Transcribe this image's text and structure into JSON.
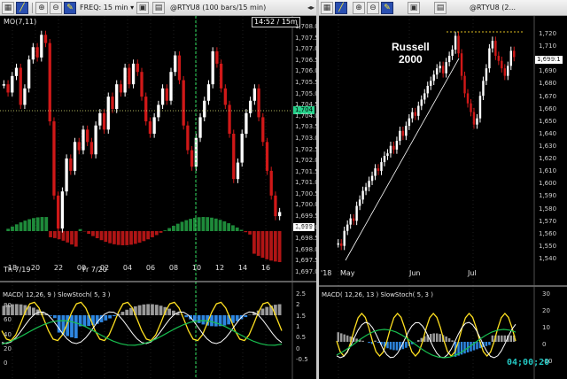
{
  "colors": {
    "background": "#000000",
    "up_bar": "#ffffff",
    "down_bar": "#d01818",
    "macd_up": "#9a9a9a",
    "macd_down": "#2e86e0",
    "macd_pos_green": "#1e8a3a",
    "macd_neg_red": "#b01515",
    "stoch_k": "#ffe020",
    "stoch_d": "#ffffff",
    "macd_line_green": "#18c050",
    "trend_line": "#ffffff",
    "resistance": "#e0c020",
    "timer": "#23c7c2"
  },
  "left": {
    "toolbar": {
      "freq_label": "FREQ: 15 min",
      "symbol_title": "@RTYU8 (100 bars/15 min)",
      "icons": [
        "cursor-icon",
        "draw-line-icon",
        "zoom-in-icon",
        "zoom-out-icon",
        "pin-icon",
        "save-icon",
        "folder-icon"
      ]
    },
    "indicator_label": "MO(7,11)",
    "time_badge": "14:52 / 15m",
    "current_price_tag": "1,704",
    "last_price_tag": "1,699",
    "price_axis": [
      "1,708.0",
      "1,707.5",
      "1,707.0",
      "1,706.5",
      "1,706.0",
      "1,705.5",
      "1,705.0",
      "1,704.5",
      "1,704.0",
      "1,703.5",
      "1,703.0",
      "1,702.5",
      "1,702.0",
      "1,701.5",
      "1,701.0",
      "1,700.5",
      "1,700.0",
      "1,699.5",
      "1,699.0",
      "1,698.5",
      "1,698.0",
      "1,697.5",
      "1,697.0"
    ],
    "time_axis": [
      "18",
      "20",
      "22",
      "00",
      "02",
      "04",
      "06",
      "08",
      "10",
      "12",
      "14",
      "16"
    ],
    "date_labels": [
      "Th 7/19",
      "Fr 7/20"
    ],
    "sub_panel": {
      "macd_label": "MACD( 12,26, 9 )",
      "stoch_label": "SlowStoch( 5, 3 )",
      "left_axis": [
        "80",
        "60",
        "40",
        "20",
        "0"
      ],
      "right_axis": [
        "2.5",
        "2",
        "1.5",
        "1",
        "0.5",
        "0",
        "-0.5"
      ]
    },
    "chart_data": {
      "type": "ohlc",
      "ylim": [
        1697.0,
        1708.0
      ],
      "closes": [
        1705.2,
        1704.8,
        1705.6,
        1706.0,
        1704.2,
        1705.0,
        1706.4,
        1707.0,
        1706.5,
        1707.6,
        1707.2,
        1703.4,
        1699.8,
        1698.2,
        1700.0,
        1701.6,
        1701.0,
        1702.4,
        1702.0,
        1703.0,
        1702.4,
        1701.8,
        1703.2,
        1703.8,
        1703.0,
        1704.6,
        1704.0,
        1705.2,
        1704.8,
        1706.0,
        1705.2,
        1706.2,
        1705.8,
        1704.6,
        1703.4,
        1702.8,
        1703.6,
        1704.2,
        1705.0,
        1704.4,
        1705.8,
        1706.6,
        1705.4,
        1703.2,
        1702.0,
        1701.2,
        1702.6,
        1703.6,
        1704.4,
        1705.2,
        1706.8,
        1706.2,
        1705.0,
        1704.2,
        1702.8,
        1700.6,
        1701.4,
        1702.8,
        1703.8,
        1704.4,
        1705.0,
        1703.6,
        1702.4,
        1701.0,
        1699.8,
        1698.8,
        1699.0
      ]
    }
  },
  "right": {
    "toolbar": {
      "symbol_title": "@RTYU8 (2...",
      "icons": [
        "cursor-icon",
        "draw-line-icon",
        "zoom-in-icon",
        "zoom-out-icon",
        "pin-icon",
        "save-icon",
        "folder-icon"
      ]
    },
    "annotation": "Russell\n2000",
    "annotation_line1": "Russell",
    "annotation_line2": "2000",
    "last_price_tag": "1,699.1",
    "price_axis": [
      "1,720",
      "1,710",
      "1,700",
      "1,690",
      "1,680",
      "1,670",
      "1,660",
      "1,650",
      "1,640",
      "1,630",
      "1,620",
      "1,610",
      "1,600",
      "1,590",
      "1,580",
      "1,570",
      "1,560",
      "1,550",
      "1,540"
    ],
    "time_axis": [
      "May",
      "Jun",
      "Jul"
    ],
    "year_label": "'18",
    "sub_panel": {
      "macd_label": "MACD( 12,26, 13 )",
      "stoch_label": "SlowStoch( 5, 3 )",
      "right_axis": [
        "30",
        "20",
        "10",
        "0",
        "-10"
      ],
      "timer": "04;00;20"
    },
    "chart_data": {
      "type": "ohlc",
      "ylim": [
        1535,
        1722
      ],
      "closes": [
        1550,
        1548,
        1560,
        1565,
        1570,
        1568,
        1580,
        1585,
        1592,
        1595,
        1600,
        1604,
        1610,
        1608,
        1615,
        1620,
        1622,
        1628,
        1625,
        1632,
        1640,
        1636,
        1644,
        1650,
        1655,
        1652,
        1660,
        1665,
        1670,
        1676,
        1680,
        1685,
        1690,
        1692,
        1686,
        1695,
        1700,
        1705,
        1716,
        1702,
        1684,
        1670,
        1662,
        1655,
        1645,
        1650,
        1668,
        1680,
        1690,
        1706,
        1712,
        1700,
        1696,
        1690,
        1684,
        1692,
        1704,
        1699
      ]
    }
  }
}
